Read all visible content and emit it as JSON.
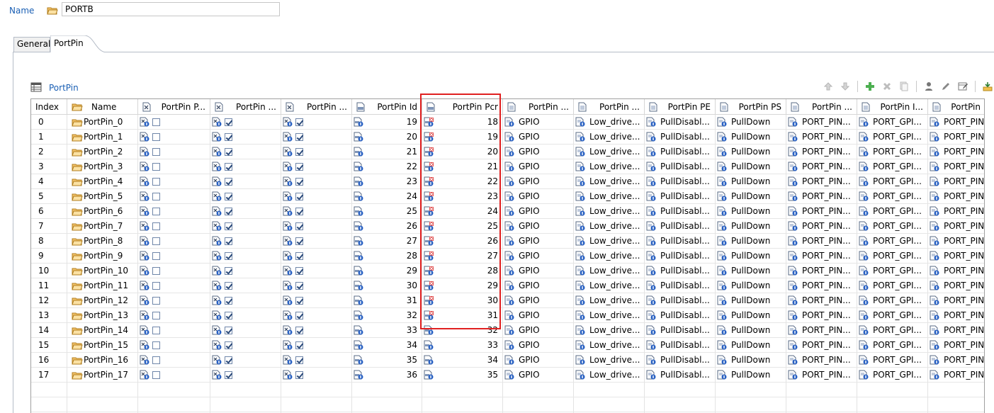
{
  "form": {
    "name_label": "Name",
    "name_value": "PORTB"
  },
  "tabs": [
    {
      "label": "General",
      "active": false
    },
    {
      "label": "PortPin",
      "active": true
    }
  ],
  "section": {
    "title": "PortPin"
  },
  "toolbar": [
    "arrow-up-icon",
    "arrow-down-icon",
    "add-icon",
    "delete-icon",
    "copy-icon",
    "user-icon",
    "edit-icon",
    "table-edit-icon",
    "import-icon"
  ],
  "table": {
    "columns": [
      "Index",
      "Name",
      "PortPin P...",
      "PortPin ...",
      "PortPin ...",
      "PortPin Id",
      "PortPin Pcr",
      "PortPin ...",
      "PortPin ...",
      "PortPin PE",
      "PortPin PS",
      "PortPin ...",
      "PortPin I...",
      "PortPin"
    ],
    "rows": [
      {
        "index": "0",
        "name": "PortPin_0",
        "c1": false,
        "c2": true,
        "c3": true,
        "id": "19",
        "pcr": "18",
        "mode": "GPIO",
        "drive": "Low_drive...",
        "pe": "PullDisabl...",
        "ps": "PullDown",
        "c11": "PORT_PIN...",
        "c12": "PORT_GPI...",
        "c13": "PORT_PIN"
      },
      {
        "index": "1",
        "name": "PortPin_1",
        "c1": false,
        "c2": true,
        "c3": true,
        "id": "20",
        "pcr": "19",
        "mode": "GPIO",
        "drive": "Low_drive...",
        "pe": "PullDisabl...",
        "ps": "PullDown",
        "c11": "PORT_PIN...",
        "c12": "PORT_GPI...",
        "c13": "PORT_PIN"
      },
      {
        "index": "2",
        "name": "PortPin_2",
        "c1": false,
        "c2": true,
        "c3": true,
        "id": "21",
        "pcr": "20",
        "mode": "GPIO",
        "drive": "Low_drive...",
        "pe": "PullDisabl...",
        "ps": "PullDown",
        "c11": "PORT_PIN...",
        "c12": "PORT_GPI...",
        "c13": "PORT_PIN"
      },
      {
        "index": "3",
        "name": "PortPin_3",
        "c1": false,
        "c2": true,
        "c3": true,
        "id": "22",
        "pcr": "21",
        "mode": "GPIO",
        "drive": "Low_drive...",
        "pe": "PullDisabl...",
        "ps": "PullDown",
        "c11": "PORT_PIN...",
        "c12": "PORT_GPI...",
        "c13": "PORT_PIN"
      },
      {
        "index": "4",
        "name": "PortPin_4",
        "c1": false,
        "c2": true,
        "c3": true,
        "id": "23",
        "pcr": "22",
        "mode": "GPIO",
        "drive": "Low_drive...",
        "pe": "PullDisabl...",
        "ps": "PullDown",
        "c11": "PORT_PIN...",
        "c12": "PORT_GPI...",
        "c13": "PORT_PIN"
      },
      {
        "index": "5",
        "name": "PortPin_5",
        "c1": false,
        "c2": true,
        "c3": true,
        "id": "24",
        "pcr": "23",
        "mode": "GPIO",
        "drive": "Low_drive...",
        "pe": "PullDisabl...",
        "ps": "PullDown",
        "c11": "PORT_PIN...",
        "c12": "PORT_GPI...",
        "c13": "PORT_PIN"
      },
      {
        "index": "6",
        "name": "PortPin_6",
        "c1": false,
        "c2": true,
        "c3": true,
        "id": "25",
        "pcr": "24",
        "mode": "GPIO",
        "drive": "Low_drive...",
        "pe": "PullDisabl...",
        "ps": "PullDown",
        "c11": "PORT_PIN...",
        "c12": "PORT_GPI...",
        "c13": "PORT_PIN"
      },
      {
        "index": "7",
        "name": "PortPin_7",
        "c1": false,
        "c2": true,
        "c3": true,
        "id": "26",
        "pcr": "25",
        "mode": "GPIO",
        "drive": "Low_drive...",
        "pe": "PullDisabl...",
        "ps": "PullDown",
        "c11": "PORT_PIN...",
        "c12": "PORT_GPI...",
        "c13": "PORT_PIN"
      },
      {
        "index": "8",
        "name": "PortPin_8",
        "c1": false,
        "c2": true,
        "c3": true,
        "id": "27",
        "pcr": "26",
        "mode": "GPIO",
        "drive": "Low_drive...",
        "pe": "PullDisabl...",
        "ps": "PullDown",
        "c11": "PORT_PIN...",
        "c12": "PORT_GPI...",
        "c13": "PORT_PIN"
      },
      {
        "index": "9",
        "name": "PortPin_9",
        "c1": false,
        "c2": true,
        "c3": true,
        "id": "28",
        "pcr": "27",
        "mode": "GPIO",
        "drive": "Low_drive...",
        "pe": "PullDisabl...",
        "ps": "PullDown",
        "c11": "PORT_PIN...",
        "c12": "PORT_GPI...",
        "c13": "PORT_PIN"
      },
      {
        "index": "10",
        "name": "PortPin_10",
        "c1": false,
        "c2": true,
        "c3": true,
        "id": "29",
        "pcr": "28",
        "mode": "GPIO",
        "drive": "Low_drive...",
        "pe": "PullDisabl...",
        "ps": "PullDown",
        "c11": "PORT_PIN...",
        "c12": "PORT_GPI...",
        "c13": "PORT_PIN"
      },
      {
        "index": "11",
        "name": "PortPin_11",
        "c1": false,
        "c2": true,
        "c3": true,
        "id": "30",
        "pcr": "29",
        "mode": "GPIO",
        "drive": "Low_drive...",
        "pe": "PullDisabl...",
        "ps": "PullDown",
        "c11": "PORT_PIN...",
        "c12": "PORT_GPI...",
        "c13": "PORT_PIN"
      },
      {
        "index": "12",
        "name": "PortPin_12",
        "c1": false,
        "c2": true,
        "c3": true,
        "id": "31",
        "pcr": "30",
        "mode": "GPIO",
        "drive": "Low_drive...",
        "pe": "PullDisabl...",
        "ps": "PullDown",
        "c11": "PORT_PIN...",
        "c12": "PORT_GPI...",
        "c13": "PORT_PIN"
      },
      {
        "index": "13",
        "name": "PortPin_13",
        "c1": false,
        "c2": true,
        "c3": true,
        "id": "32",
        "pcr": "31",
        "mode": "GPIO",
        "drive": "Low_drive...",
        "pe": "PullDisabl...",
        "ps": "PullDown",
        "c11": "PORT_PIN...",
        "c12": "PORT_GPI...",
        "c13": "PORT_PIN"
      },
      {
        "index": "14",
        "name": "PortPin_14",
        "c1": false,
        "c2": true,
        "c3": true,
        "id": "33",
        "pcr": "32",
        "mode": "GPIO",
        "drive": "Low_drive...",
        "pe": "PullDisabl...",
        "ps": "PullDown",
        "c11": "PORT_PIN...",
        "c12": "PORT_GPI...",
        "c13": "PORT_PIN"
      },
      {
        "index": "15",
        "name": "PortPin_15",
        "c1": false,
        "c2": true,
        "c3": true,
        "id": "34",
        "pcr": "33",
        "mode": "GPIO",
        "drive": "Low_drive...",
        "pe": "PullDisabl...",
        "ps": "PullDown",
        "c11": "PORT_PIN...",
        "c12": "PORT_GPI...",
        "c13": "PORT_PIN"
      },
      {
        "index": "16",
        "name": "PortPin_16",
        "c1": false,
        "c2": true,
        "c3": true,
        "id": "35",
        "pcr": "34",
        "mode": "GPIO",
        "drive": "Low_drive...",
        "pe": "PullDisabl...",
        "ps": "PullDown",
        "c11": "PORT_PIN...",
        "c12": "PORT_GPI...",
        "c13": "PORT_PIN"
      },
      {
        "index": "17",
        "name": "PortPin_17",
        "c1": false,
        "c2": true,
        "c3": true,
        "id": "36",
        "pcr": "35",
        "mode": "GPIO",
        "drive": "Low_drive...",
        "pe": "PullDisabl...",
        "ps": "PullDown",
        "c11": "PORT_PIN...",
        "c12": "PORT_GPI...",
        "c13": "PORT_PIN"
      }
    ]
  },
  "colors": {
    "link_blue": "#1a5fb4",
    "highlight_red": "#e02020",
    "grid_line": "#e3e3e3"
  }
}
